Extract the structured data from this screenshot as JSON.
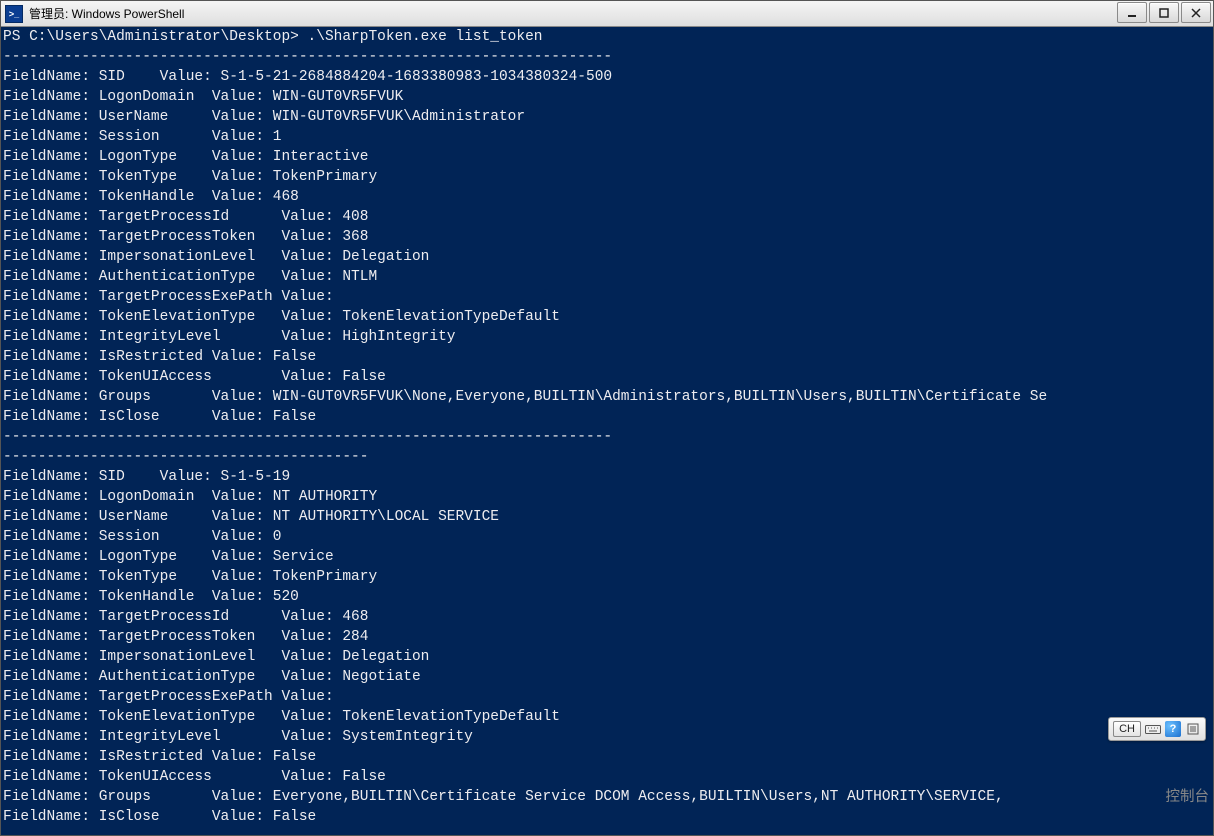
{
  "window": {
    "title": "管理员: Windows PowerShell"
  },
  "ime": {
    "mode": "CH"
  },
  "cut_text_1": "控制台",
  "terminal": {
    "prompt": "PS C:\\Users\\Administrator\\Desktop> ",
    "command": ".\\SharpToken.exe list_token",
    "sep_long": "----------------------------------------------------------------------",
    "sep_short": "------------------------------------------",
    "tokens": [
      {
        "sid": "S-1-5-21-2684884204-1683380983-1034380324-500",
        "LogonDomain": "WIN-GUT0VR5FVUK",
        "UserName": "WIN-GUT0VR5FVUK\\Administrator",
        "Session": "1",
        "LogonType": "Interactive",
        "TokenType": "TokenPrimary",
        "TokenHandle": "468",
        "TargetProcessId": "408",
        "TargetProcessToken": "368",
        "ImpersonationLevel": "Delegation",
        "AuthenticationType": "NTLM",
        "TargetProcessExePath": "",
        "TokenElevationType": "TokenElevationTypeDefault",
        "IntegrityLevel": "HighIntegrity",
        "IsRestricted": "False",
        "TokenUIAccess": "False",
        "Groups": "WIN-GUT0VR5FVUK\\None,Everyone,BUILTIN\\Administrators,BUILTIN\\Users,BUILTIN\\Certificate Se",
        "IsClose": "False"
      },
      {
        "sid": "S-1-5-19",
        "LogonDomain": "NT AUTHORITY",
        "UserName": "NT AUTHORITY\\LOCAL SERVICE",
        "Session": "0",
        "LogonType": "Service",
        "TokenType": "TokenPrimary",
        "TokenHandle": "520",
        "TargetProcessId": "468",
        "TargetProcessToken": "284",
        "ImpersonationLevel": "Delegation",
        "AuthenticationType": "Negotiate",
        "TargetProcessExePath": "",
        "TokenElevationType": "TokenElevationTypeDefault",
        "IntegrityLevel": "SystemIntegrity",
        "IsRestricted": "False",
        "TokenUIAccess": "False",
        "Groups": "Everyone,BUILTIN\\Certificate Service DCOM Access,BUILTIN\\Users,NT AUTHORITY\\SERVICE,",
        "IsClose": "False"
      }
    ]
  }
}
